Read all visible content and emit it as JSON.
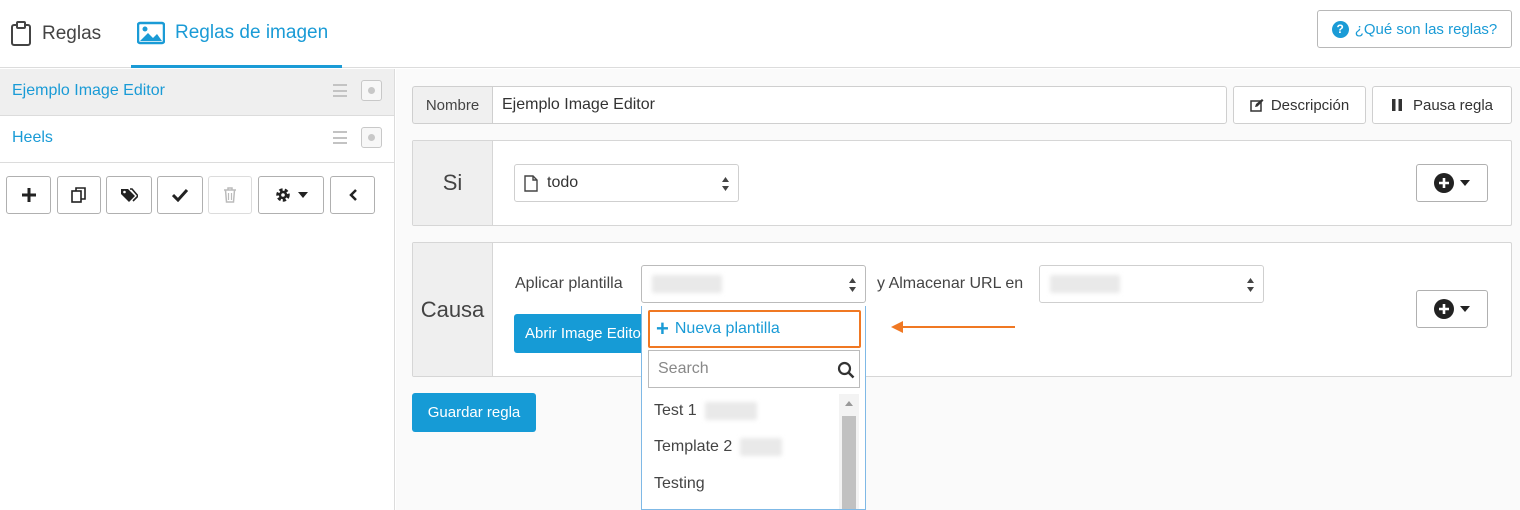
{
  "tabs": [
    {
      "label": "Reglas",
      "icon": "clipboard-icon"
    },
    {
      "label": "Reglas de imagen",
      "icon": "image-icon"
    }
  ],
  "help_button": "¿Qué son las reglas?",
  "rules": [
    {
      "label": "Ejemplo Image Editor",
      "active": true
    },
    {
      "label": "Heels",
      "active": false
    }
  ],
  "toolbar_icons": [
    "plus-icon",
    "copy-icon",
    "tags-icon",
    "check-icon",
    "trash-icon",
    "gear-icon",
    "chevron-left-icon"
  ],
  "rule_form": {
    "name_label": "Nombre",
    "name_value": "Ejemplo Image Editor",
    "description_button": "Descripción",
    "pause_button": "Pausa regla"
  },
  "condition": {
    "label": "Si",
    "select_value": "todo"
  },
  "action": {
    "label": "Causa",
    "apply_template_label": "Aplicar plantilla",
    "store_url_label": "y Almacenar URL en",
    "open_editor_button": "Abrir Image Editor"
  },
  "save_button": "Guardar regla",
  "dropdown": {
    "new_template": "Nueva plantilla",
    "search_placeholder": "Search",
    "options": [
      "Test 1",
      "Template 2",
      "Testing"
    ]
  },
  "colors": {
    "accent": "#1a9bd6",
    "highlight": "#f07823",
    "button_blue": "#169bd6"
  }
}
